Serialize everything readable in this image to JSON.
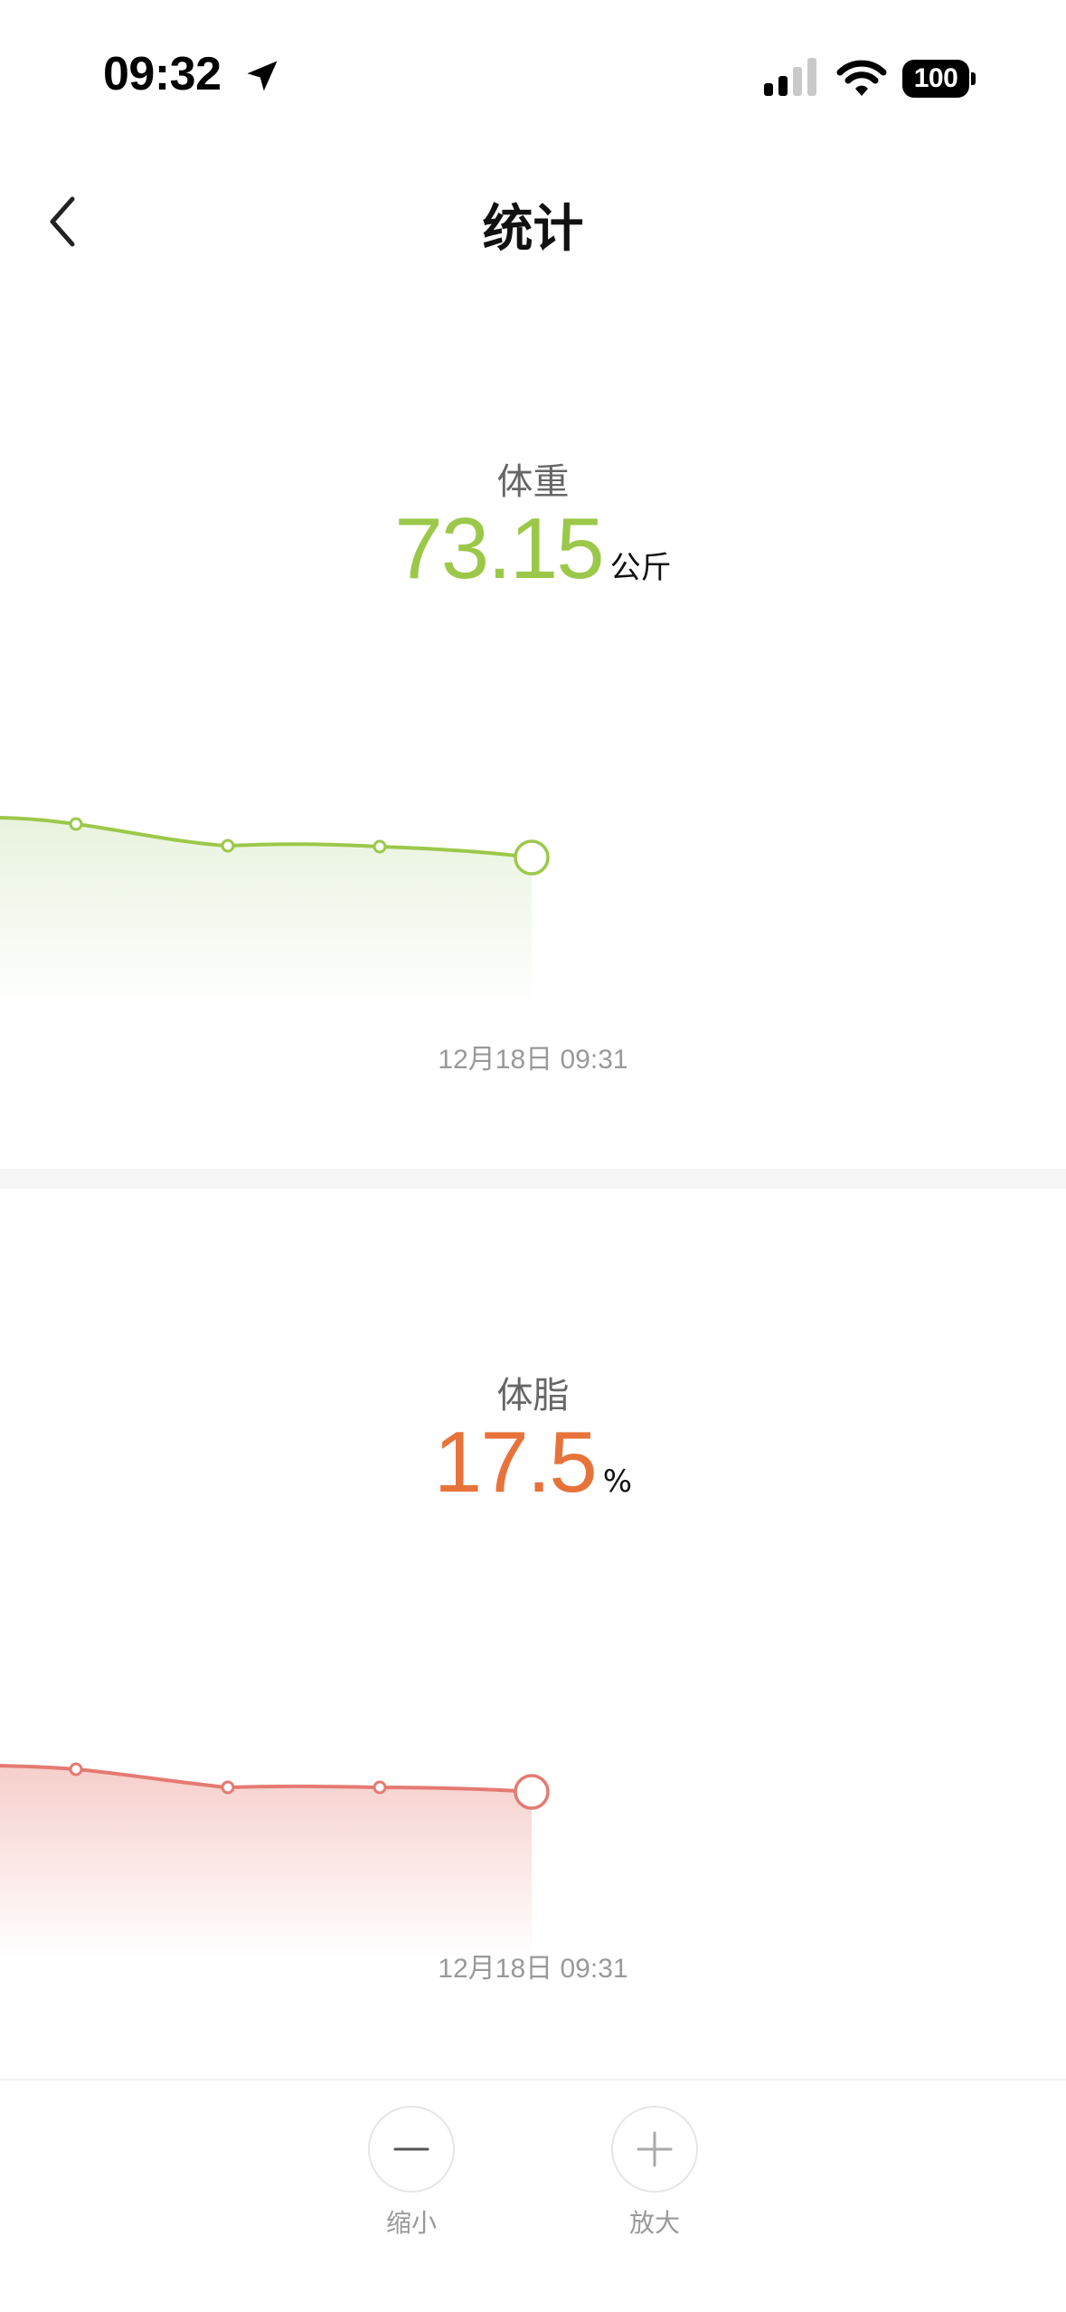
{
  "status_bar": {
    "time": "09:32",
    "battery": "100",
    "icons": [
      "location-arrow-icon",
      "cellular-signal-icon",
      "wifi-icon",
      "battery-icon"
    ]
  },
  "nav": {
    "title": "统计",
    "back_icon": "chevron-left-icon"
  },
  "weight": {
    "label": "体重",
    "value": "73.15",
    "unit": "公斤",
    "date": "12月18日 09:31",
    "accent": "#9CC84A",
    "fill_color": "#EAF4E1"
  },
  "body_fat": {
    "label": "体脂",
    "value": "17.5",
    "unit": "%",
    "date": "12月18日 09:31",
    "accent": "#E8733A",
    "line_color": "#E57A72",
    "fill_color": "#F8D3D0"
  },
  "toolbar": {
    "zoom_out_label": "缩小",
    "zoom_in_label": "放大",
    "zoom_out_icon": "minus-icon",
    "zoom_in_icon": "plus-icon"
  },
  "colors": {
    "background": "#FFFFFF",
    "divider": "#F6F6F6",
    "muted_text": "#999999"
  }
}
